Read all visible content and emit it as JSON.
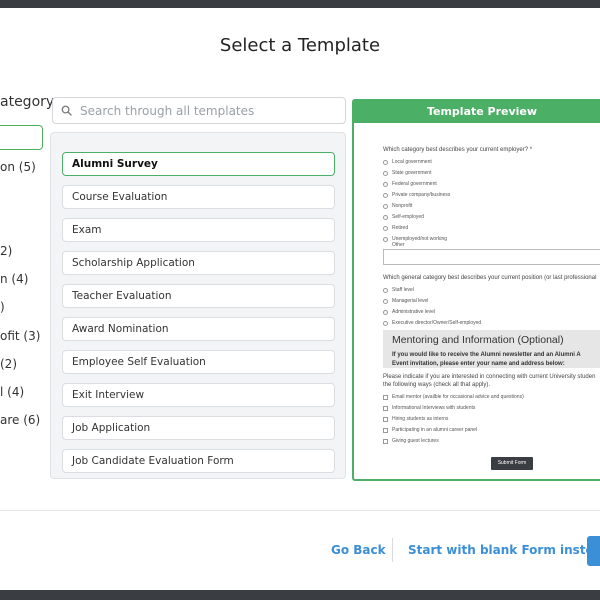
{
  "title": "Select a Template",
  "sidebar": {
    "heading": "ategory",
    "items": [
      "on (5)",
      "2)",
      "n (4)",
      ")",
      "ofit (3)",
      "(2)",
      "l (4)",
      "are (6)"
    ]
  },
  "search": {
    "placeholder": "Search through all templates",
    "icon": "search-icon"
  },
  "templates": [
    "Alumni Survey",
    "Course Evaluation",
    "Exam",
    "Scholarship Application",
    "Teacher Evaluation",
    "Award Nomination",
    "Employee Self Evaluation",
    "Exit Interview",
    "Job Application",
    "Job Candidate Evaluation Form"
  ],
  "selected_template": "Alumni Survey",
  "preview": {
    "header": "Template Preview",
    "q1": "Which category best describes your current employer? *",
    "q1_options": [
      "Local government",
      "State government",
      "Federal government",
      "Private company/business",
      "Nonprofit",
      "Self-employed",
      "Retired",
      "Unemployed/not working",
      "Other"
    ],
    "q2": "Which general category best describes your current position (or last professional",
    "q2_options": [
      "Staff level",
      "Managerial level",
      "Administrative level",
      "Executive director/Owner/Self-employed"
    ],
    "section_title": "Mentoring and Information (Optional)",
    "section_sub_1": "If you would like to receive the Alumni newsletter and an Alumni A",
    "section_sub_2": "Event invitation, please enter your name and address below:",
    "q3_line1": "Please indicate if you are interested in connecting with current University studen",
    "q3_line2": "the following ways (check all that apply).",
    "q3_options": [
      "Email mentor (availble for occasional advice and questions)",
      "Informational Interviews with students",
      "Hiring students as interns",
      "Participating in an alumni career panel",
      "Giving guest lectures"
    ],
    "submit": "Submit Form"
  },
  "footer": {
    "go_back": "Go Back",
    "blank_form": "Start with blank Form instead"
  },
  "colors": {
    "accent_green": "#4caf66",
    "link_blue": "#3b8fd6",
    "backdrop": "#3a3d42"
  }
}
